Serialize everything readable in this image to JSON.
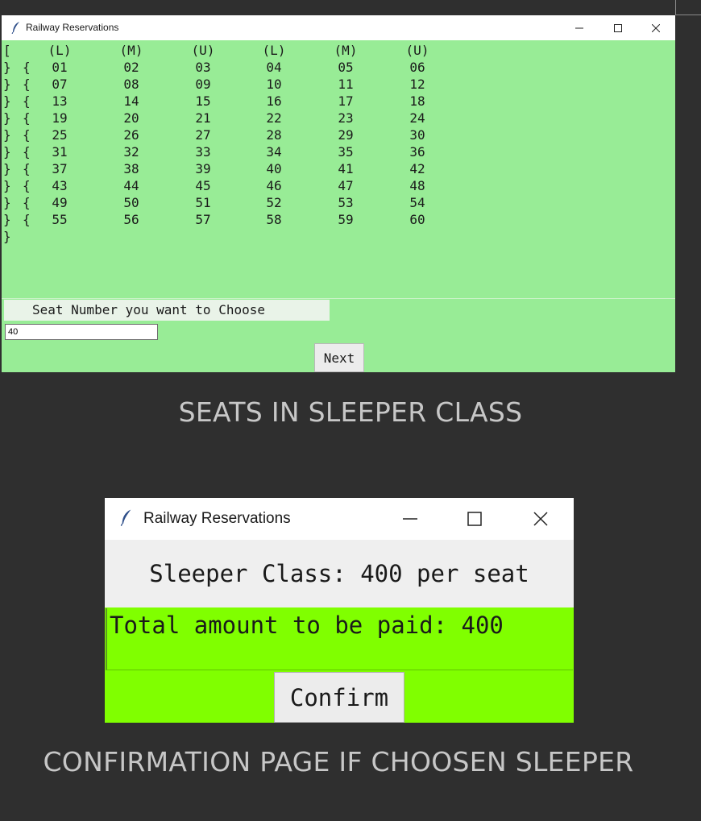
{
  "window1": {
    "title": "Railway Reservations",
    "header_row": [
      "(L)",
      "(M)",
      "(U)",
      "(L)",
      "(M)",
      "(U)"
    ],
    "rows": [
      [
        "01",
        "02",
        "03",
        "04",
        "05",
        "06"
      ],
      [
        "07",
        "08",
        "09",
        "10",
        "11",
        "12"
      ],
      [
        "13",
        "14",
        "15",
        "16",
        "17",
        "18"
      ],
      [
        "19",
        "20",
        "21",
        "22",
        "23",
        "24"
      ],
      [
        "25",
        "26",
        "27",
        "28",
        "29",
        "30"
      ],
      [
        "31",
        "32",
        "33",
        "34",
        "35",
        "36"
      ],
      [
        "37",
        "38",
        "39",
        "40",
        "41",
        "42"
      ],
      [
        "43",
        "44",
        "45",
        "46",
        "47",
        "48"
      ],
      [
        "49",
        "50",
        "51",
        "52",
        "53",
        "54"
      ],
      [
        "55",
        "56",
        "57",
        "58",
        "59",
        "60"
      ]
    ],
    "seat_label": "Seat Number you want to Choose",
    "seat_input_value": "40",
    "next_label": "Next",
    "background": "#98ec96"
  },
  "caption1": "SEATS IN SLEEPER CLASS",
  "window2": {
    "title": "Railway Reservations",
    "price_text": "Sleeper Class: 400 per seat",
    "total_text": "Total amount to be paid: 400",
    "confirm_label": "Confirm",
    "background": "#80ff00"
  },
  "caption2": "CONFIRMATION PAGE IF CHOOSEN SLEEPER",
  "icons": {
    "app": "feather-icon",
    "minimize": "minimize-icon",
    "maximize": "maximize-icon",
    "close": "close-icon"
  }
}
